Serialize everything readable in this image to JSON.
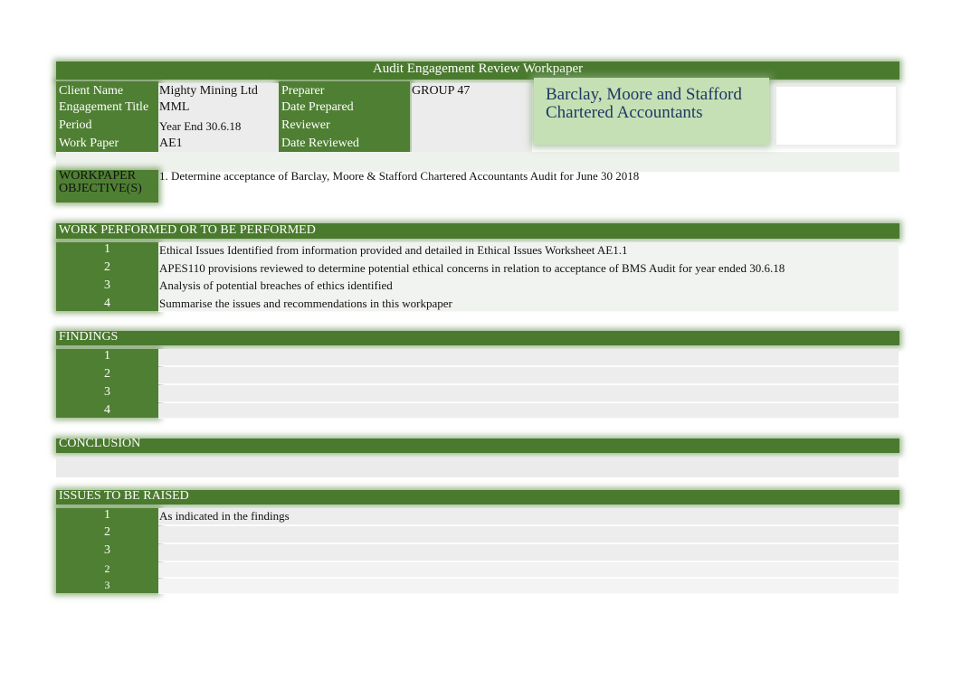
{
  "title": "Audit Engagement Review Workpaper",
  "info": {
    "client_name_label": "Client Name",
    "client_name": "Mighty Mining Ltd",
    "engagement_title_label": "Engagement Title",
    "engagement_title": "MML",
    "period_label": "Period",
    "period": "Year End 30.6.18",
    "work_paper_label": "Work Paper",
    "work_paper": "AE1",
    "preparer_label": "Preparer",
    "preparer": "GROUP 47",
    "date_prepared_label": "Date Prepared",
    "reviewer_label": "Reviewer",
    "date_reviewed_label": "Date Reviewed"
  },
  "firm": {
    "line1": "Barclay, Moore and Stafford",
    "line2": "Chartered Accountants"
  },
  "objective": {
    "label_line1": "WORKPAPER",
    "label_line2": "OBJECTIVE(S)",
    "text": "1. Determine acceptance of Barclay, Moore & Stafford Chartered Accountants Audit for June 30 2018"
  },
  "work": {
    "heading": "WORK PERFORMED OR TO BE PERFORMED",
    "items": [
      {
        "n": "1",
        "text": "Ethical Issues Identified from information provided and detailed in Ethical Issues Worksheet AE1.1"
      },
      {
        "n": "2",
        "text": "APES110 provisions reviewed to determine potential ethical concerns in relation to acceptance of BMS Audit for year ended 30.6.18"
      },
      {
        "n": "3",
        "text": "Analysis of potential breaches of ethics identified"
      },
      {
        "n": "4",
        "text": "Summarise the issues and recommendations in this workpaper"
      }
    ]
  },
  "findings": {
    "heading": "FINDINGS",
    "items": [
      {
        "n": "1"
      },
      {
        "n": "2"
      },
      {
        "n": "3"
      },
      {
        "n": "4"
      }
    ]
  },
  "conclusion": {
    "heading": "CONCLUSION"
  },
  "issues": {
    "heading": "ISSUES TO BE RAISED",
    "items": [
      {
        "n": "1",
        "text": "As indicated in the findings"
      },
      {
        "n": "2"
      },
      {
        "n": "3"
      },
      {
        "n": "2"
      },
      {
        "n": "3"
      }
    ]
  },
  "colors": {
    "green": "#4f7f33",
    "light_green": "#c5e0b4",
    "firm_text": "#1f3864"
  }
}
